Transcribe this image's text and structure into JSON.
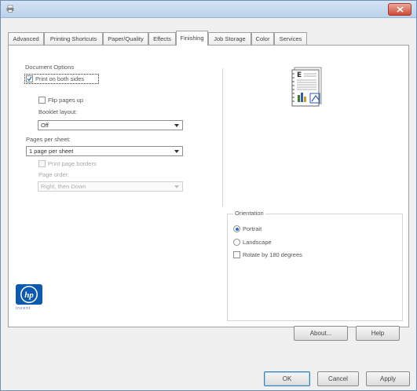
{
  "tabs": [
    {
      "label": "Advanced"
    },
    {
      "label": "Printing Shortcuts"
    },
    {
      "label": "Paper/Quality"
    },
    {
      "label": "Effects"
    },
    {
      "label": "Finishing"
    },
    {
      "label": "Job Storage"
    },
    {
      "label": "Color"
    },
    {
      "label": "Services"
    }
  ],
  "active_tab": "Finishing",
  "document_options": {
    "group_label": "Document Options",
    "print_both_sides": {
      "label": "Print on both sides",
      "checked": true
    },
    "flip_pages_up": {
      "label": "Flip pages up",
      "checked": false
    },
    "booklet_layout": {
      "label": "Booklet layout:",
      "value": "Off"
    },
    "pages_per_sheet": {
      "label": "Pages per sheet:",
      "value": "1 page per sheet"
    },
    "print_page_borders": {
      "label": "Print page borders",
      "checked": false,
      "enabled": false
    },
    "page_order": {
      "label": "Page order:",
      "value": "Right, then Down",
      "enabled": false
    }
  },
  "orientation": {
    "group_label": "Orientation",
    "portrait": {
      "label": "Portrait",
      "selected": true
    },
    "landscape": {
      "label": "Landscape",
      "selected": false
    },
    "rotate_180": {
      "label": "Rotate by 180 degrees",
      "checked": false
    }
  },
  "brand": {
    "logo_text": "hp",
    "sub_text": "invent"
  },
  "buttons": {
    "about": "About...",
    "help": "Help",
    "ok": "OK",
    "cancel": "Cancel",
    "apply": "Apply"
  },
  "colors": {
    "accent": "#2c6fc8",
    "hp_blue": "#0b5ab0",
    "close_red": "#cf4b33"
  }
}
